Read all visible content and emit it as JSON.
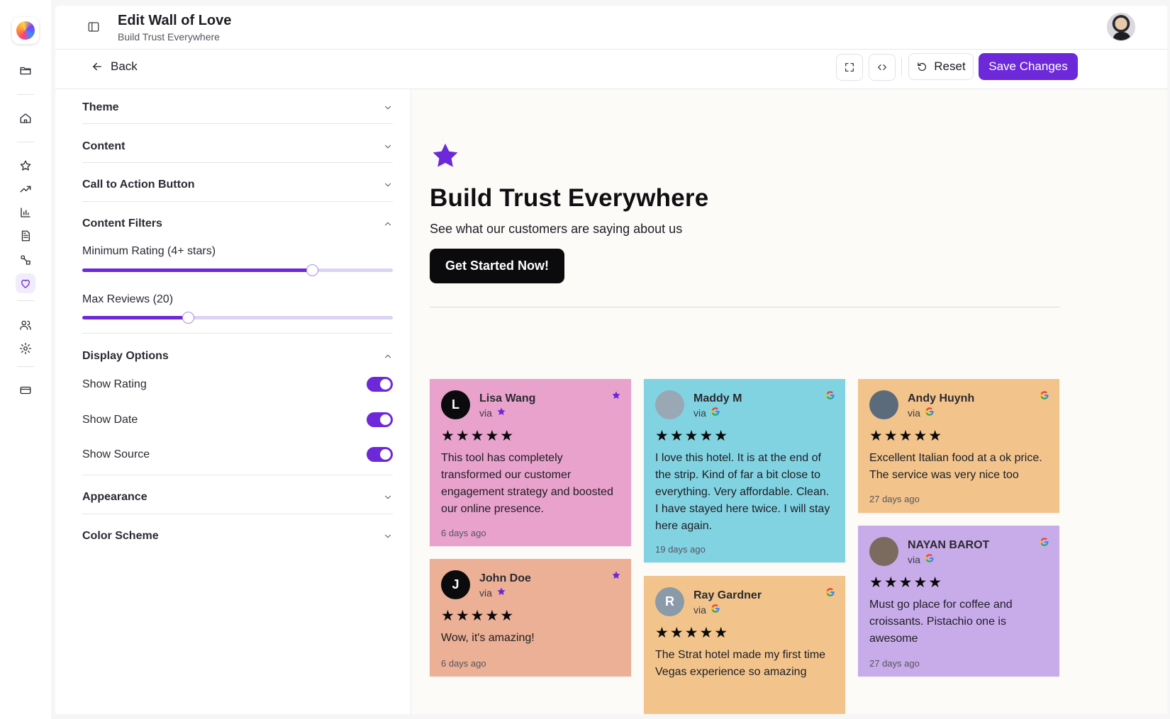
{
  "header": {
    "title": "Edit Wall of Love",
    "subtitle": "Build Trust Everywhere"
  },
  "actions": {
    "back_label": "Back",
    "reset_label": "Reset",
    "save_label": "Save Changes"
  },
  "settings": {
    "sections": {
      "theme": "Theme",
      "content": "Content",
      "cta_button": "Call to Action Button",
      "content_filters": "Content Filters",
      "display_options": "Display Options",
      "appearance": "Appearance",
      "color_scheme": "Color Scheme"
    },
    "min_rating": {
      "label": "Minimum Rating (4+ stars)",
      "value_fraction": 0.74
    },
    "max_reviews": {
      "label": "Max Reviews (20)",
      "value_fraction": 0.34
    },
    "toggles": {
      "show_rating": {
        "label": "Show Rating",
        "on": true
      },
      "show_date": {
        "label": "Show Date",
        "on": true
      },
      "show_source": {
        "label": "Show Source",
        "on": true
      }
    }
  },
  "preview": {
    "title": "Build Trust Everywhere",
    "subtitle": "See what our customers are saying about us",
    "cta_label": "Get Started Now!",
    "via_label": "via",
    "stars": "★★★★★",
    "reviews": [
      {
        "name": "Lisa Wang",
        "initial": "L",
        "source": "star",
        "color": "#e9a2cc",
        "text": "This tool has completely transformed our customer engagement strategy and boosted our online presence.",
        "date": "6 days ago"
      },
      {
        "name": "Maddy M",
        "initial": "",
        "source": "google",
        "color": "#82d3e2",
        "text": "I love this hotel. It is at the end of the strip. Kind of far a bit close to everything. Very affordable. Clean. I have stayed here twice. I will stay here again.",
        "date": "19 days ago"
      },
      {
        "name": "Andy Huynh",
        "initial": "",
        "source": "google",
        "color": "#f2c48c",
        "text": "Excellent Italian food at a ok price. The service was very nice too",
        "date": "27 days ago"
      },
      {
        "name": "John Doe",
        "initial": "J",
        "source": "star",
        "color": "#ebb095",
        "text": "Wow, it's amazing!",
        "date": "6 days ago"
      },
      {
        "name": "Ray Gardner",
        "initial": "R",
        "source": "google",
        "color": "#f2c48c",
        "text": "The Strat hotel made my first time Vegas experience so amazing",
        "date": ""
      },
      {
        "name": "NAYAN BAROT",
        "initial": "",
        "source": "google",
        "color": "#c8acea",
        "text": "Must go place for coffee and croissants. Pistachio one is awesome",
        "date": "27 days ago"
      }
    ]
  },
  "colors": {
    "accent": "#6d28d9",
    "cta_bg": "#0b0b0d"
  }
}
